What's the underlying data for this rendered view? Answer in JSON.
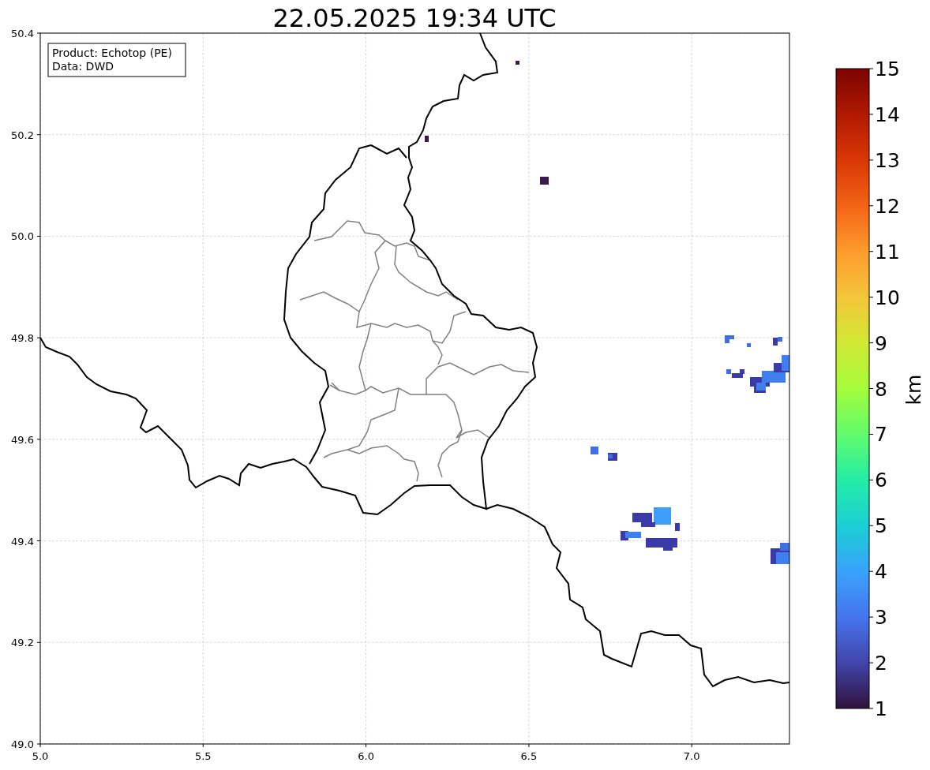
{
  "title": "22.05.2025 19:34 UTC",
  "info_box": {
    "lines": [
      "Product: Echotop (PE)",
      "Data: DWD"
    ]
  },
  "map": {
    "x_ticks": [
      "5.0",
      "5.5",
      "6.0",
      "6.5",
      "7.0"
    ],
    "y_ticks": [
      "50.4",
      "50.2",
      "50.0",
      "49.8",
      "49.6",
      "49.4",
      "49.2",
      "49.0"
    ]
  },
  "colorbar": {
    "label": "km",
    "ticks": [
      "15",
      "14",
      "13",
      "12",
      "11",
      "10",
      "9",
      "8",
      "7",
      "6",
      "5",
      "4",
      "3",
      "2",
      "1"
    ]
  }
}
